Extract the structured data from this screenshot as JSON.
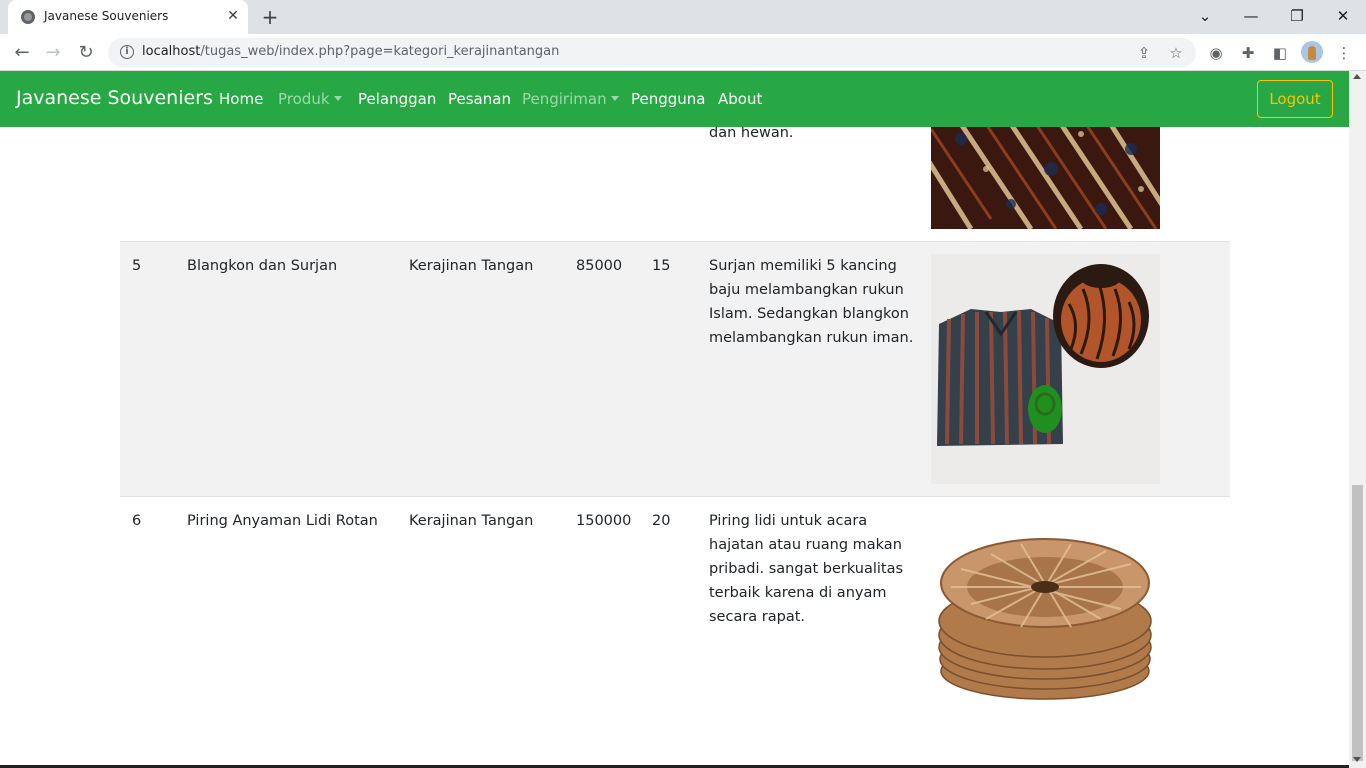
{
  "browser": {
    "tab_title": "Javanese Souveniers",
    "tab_close": "✕",
    "new_tab": "+",
    "url_host": "localhost",
    "url_path": "/tugas_web/index.php?page=kategori_kerajinantangan",
    "controls": {
      "minimize": "—",
      "restore": "❐",
      "close": "✕",
      "tab_search": "⌄"
    }
  },
  "navbar": {
    "brand": "Javanese Souveniers",
    "links": [
      {
        "label": "Home",
        "muted": false
      },
      {
        "label": "Produk",
        "muted": true,
        "dropdown": true
      },
      {
        "label": "Pelanggan",
        "muted": false
      },
      {
        "label": "Pesanan",
        "muted": false
      },
      {
        "label": "Pengiriman",
        "muted": true,
        "dropdown": true
      },
      {
        "label": "Pengguna",
        "muted": false
      },
      {
        "label": "About",
        "muted": false
      }
    ],
    "logout": "Logout",
    "bg_color": "#28a745",
    "logout_color": "#ffc107"
  },
  "table": {
    "partial_row": {
      "desc_tail": "dan hewan.",
      "image": "batik-image"
    },
    "rows": [
      {
        "no": "5",
        "name": "Blangkon dan Surjan",
        "category": "Kerajinan Tangan",
        "price": "85000",
        "stock": "15",
        "desc": "Surjan memiliki 5 kancing baju melambangkan rukun Islam. Sedangkan blangkon melambangkan rukun iman.",
        "image": "blangkon-surjan-image"
      },
      {
        "no": "6",
        "name": "Piring Anyaman Lidi Rotan",
        "category": "Kerajinan Tangan",
        "price": "150000",
        "stock": "20",
        "desc": "Piring lidi untuk acara hajatan atau ruang makan pribadi. sangat berkualitas terbaik karena di anyam secara rapat.",
        "image": "rattan-plate-image"
      }
    ]
  }
}
